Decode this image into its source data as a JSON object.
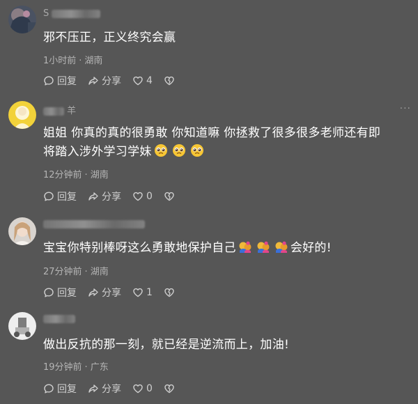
{
  "comments": [
    {
      "username": "S",
      "text": "邪不压正，正义终究会赢",
      "time": "1小时前",
      "location": "湖南",
      "reply_label": "回复",
      "share_label": "分享",
      "likes": "4"
    },
    {
      "username": "",
      "username_suffix": "羊",
      "text_line1": "姐姐 你真的真的很勇敢 你知道嘛 你拯救了很多很多老师还有即",
      "text_line2": "将踏入涉外学习学妹",
      "time": "12分钟前",
      "location": "湖南",
      "reply_label": "回复",
      "share_label": "分享",
      "likes": "0"
    },
    {
      "username": "",
      "text_main": "宝宝你特别棒呀这么勇敢地保护自己",
      "text_end": "会好的!",
      "time": "27分钟前",
      "location": "湖南",
      "reply_label": "回复",
      "share_label": "分享",
      "likes": "1"
    },
    {
      "username": "",
      "text": "做出反抗的那一刻，就已经是逆流而上，加油!",
      "time": "19分钟前",
      "location": "广东",
      "reply_label": "回复",
      "share_label": "分享",
      "likes": "0"
    }
  ],
  "meta_separator": "·",
  "icons": {
    "reply": "reply-bubble-icon",
    "share": "share-arrow-icon",
    "like": "heart-icon",
    "dislike": "broken-heart-icon",
    "more": "more-dots-icon"
  },
  "colors": {
    "background": "#565656",
    "text": "#ffffff",
    "meta": "#b5b5b5",
    "username": "#a9a9a9"
  }
}
